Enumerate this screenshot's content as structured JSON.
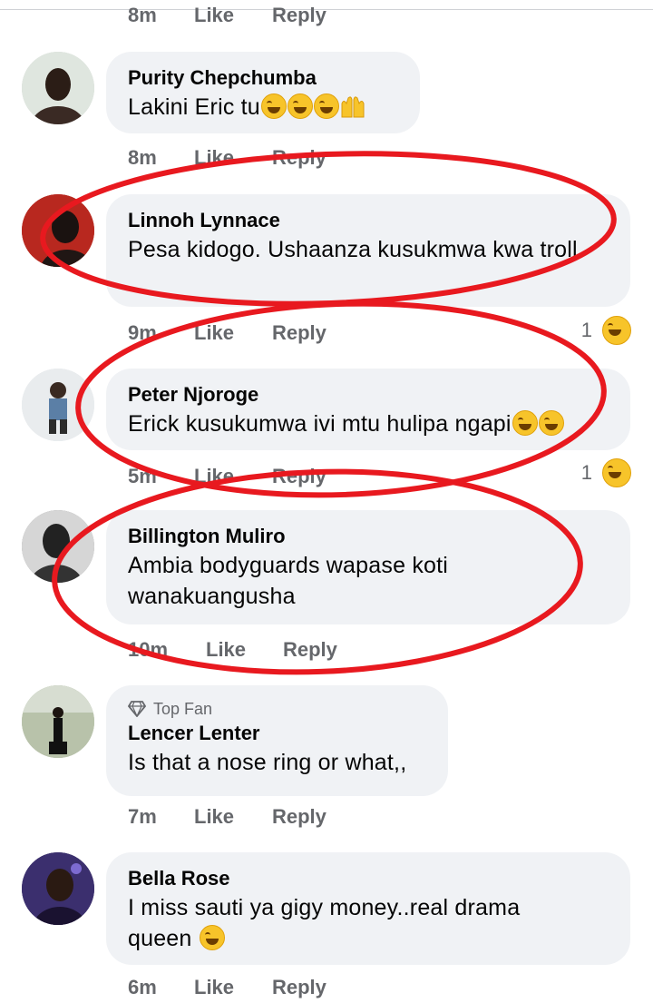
{
  "top_meta": {
    "time": "8m",
    "like": "Like",
    "reply": "Reply"
  },
  "comments": [
    {
      "name": "Purity Chepchumba",
      "text": "Lakini Eric tu",
      "time": "8m",
      "like": "Like",
      "reply": "Reply",
      "emojis": [
        "rofl-emoji",
        "rofl-emoji",
        "rofl-emoji",
        "raised-hands-emoji"
      ],
      "avatar_color": "#c7cfc7"
    },
    {
      "name": "Linnoh Lynnace",
      "text": "Pesa kidogo. Ushaanza  kusukmwa kwa troll",
      "time": "9m",
      "like": "Like",
      "reply": "Reply",
      "reaction_count": "1",
      "avatar_color": "#b3261e"
    },
    {
      "name": "Peter Njoroge",
      "text": "Erick kusukumwa ivi mtu hulipa ngapi",
      "time": "5m",
      "like": "Like",
      "reply": "Reply",
      "reaction_count": "1",
      "emojis": [
        "grin-emoji",
        "laugh-emoji"
      ],
      "avatar_color": "#dfe3e6"
    },
    {
      "name": "Billington Muliro",
      "text": "Ambia bodyguards wapase koti wanakuangusha",
      "time": "10m",
      "like": "Like",
      "reply": "Reply",
      "avatar_color": "#8a8a8a"
    },
    {
      "badge": "Top Fan",
      "name": "Lencer Lenter",
      "text": "Is that a nose ring or what,,",
      "time": "7m",
      "like": "Like",
      "reply": "Reply",
      "avatar_color": "#a9b79a"
    },
    {
      "name": "Bella Rose",
      "text": "I miss sauti ya gigy money..real drama queen",
      "time": "6m",
      "like": "Like",
      "reply": "Reply",
      "emojis": [
        "rofl-emoji"
      ],
      "avatar_color": "#2a2350"
    }
  ],
  "colors": {
    "bubble": "#f0f2f5",
    "meta_text": "#65676b",
    "annotation_red": "#e8191f",
    "emoji_yellow": "#f7c42a"
  }
}
